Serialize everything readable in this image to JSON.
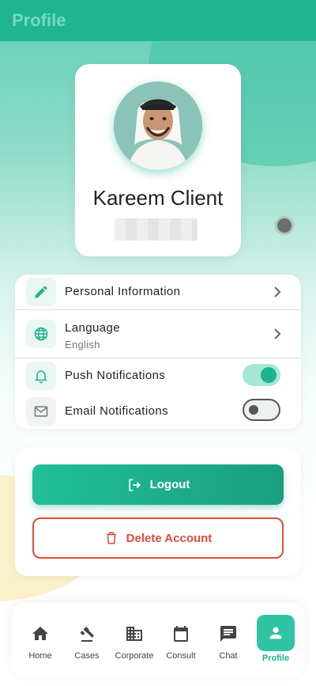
{
  "header": {
    "title": "Profile"
  },
  "profile": {
    "name": "Kareem Client"
  },
  "settings": {
    "personal_info": {
      "label": "Personal Information",
      "icon": "pencil-icon"
    },
    "language": {
      "label": "Language",
      "value": "English",
      "icon": "globe-icon"
    },
    "push": {
      "label": "Push Notifications",
      "enabled": true,
      "icon": "bell-icon"
    },
    "email": {
      "label": "Email Notifications",
      "enabled": false,
      "icon": "mail-icon"
    }
  },
  "actions": {
    "logout_label": "Logout",
    "delete_label": "Delete Account"
  },
  "nav": {
    "items": [
      {
        "label": "Home",
        "icon": "home-icon"
      },
      {
        "label": "Cases",
        "icon": "gavel-icon"
      },
      {
        "label": "Corporate",
        "icon": "building-icon"
      },
      {
        "label": "Consult",
        "icon": "calendar-icon"
      },
      {
        "label": "Chat",
        "icon": "chat-icon"
      },
      {
        "label": "Profile",
        "icon": "person-icon",
        "active": true
      }
    ]
  },
  "colors": {
    "accent": "#1fb593",
    "danger": "#e04b3a"
  }
}
